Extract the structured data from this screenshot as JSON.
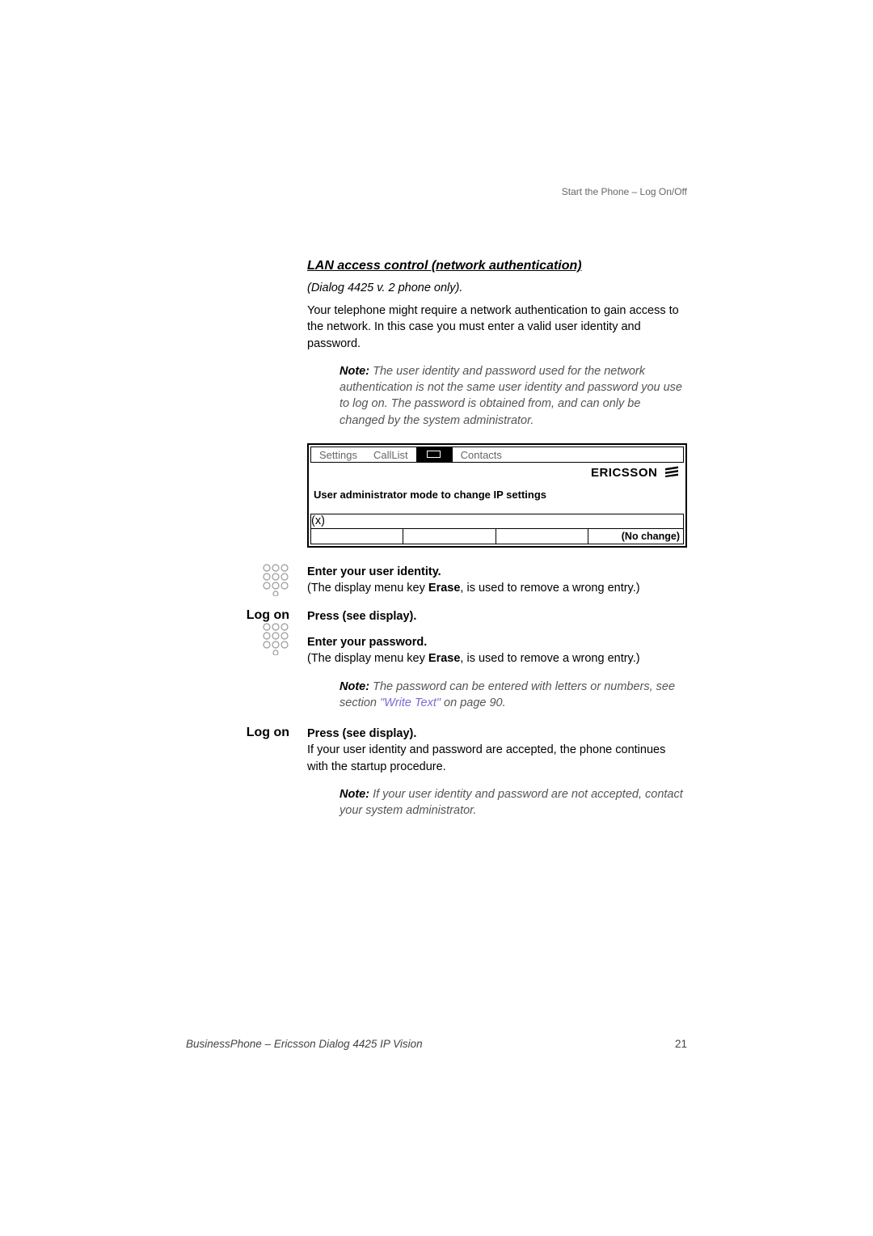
{
  "header": {
    "right_label": "Start the Phone – Log On/Off"
  },
  "section": {
    "title": "LAN access control (network authentication)",
    "subtitle": "(Dialog 4425 v. 2 phone only).",
    "intro": "Your telephone might require a network authentication to gain access to the network. In this case you must enter a valid user identity and password."
  },
  "note1": {
    "label": "Note:",
    "text": " The user identity and password used for the network authentication is not the same user identity and password you use to log on. The password is obtained from, and can only be changed by the system administrator."
  },
  "screen": {
    "tabs": {
      "settings": "Settings",
      "calllist": "CallList",
      "contacts": "Contacts"
    },
    "brand": "ERICSSON",
    "message": "User administrator mode to change IP settings",
    "x": "(x)",
    "nochange": "(No change)"
  },
  "step1": {
    "bold": "Enter your user identity.",
    "paren_prefix": "(The display menu key ",
    "erase": "Erase",
    "paren_suffix": ", is used to remove a wrong entry.)"
  },
  "step2": {
    "left": "Log on",
    "bold": "Press (see display)."
  },
  "step3": {
    "bold": "Enter your password.",
    "paren_prefix": "(The display menu key ",
    "erase": "Erase",
    "paren_suffix": ", is used to remove a wrong entry.)"
  },
  "note2": {
    "label": "Note:",
    "text_prefix": " The password can be entered with letters or numbers, see section ",
    "link": "\"Write Text\"",
    "text_suffix": " on page 90."
  },
  "step4": {
    "left": "Log on",
    "bold": "Press (see display).",
    "body": "If your user identity and password are accepted, the phone continues with the startup procedure."
  },
  "note3": {
    "label": "Note:",
    "text": " If your user identity and password are not accepted, contact your system administrator."
  },
  "footer": {
    "title": "BusinessPhone – Ericsson Dialog 4425 IP Vision",
    "page": "21"
  }
}
